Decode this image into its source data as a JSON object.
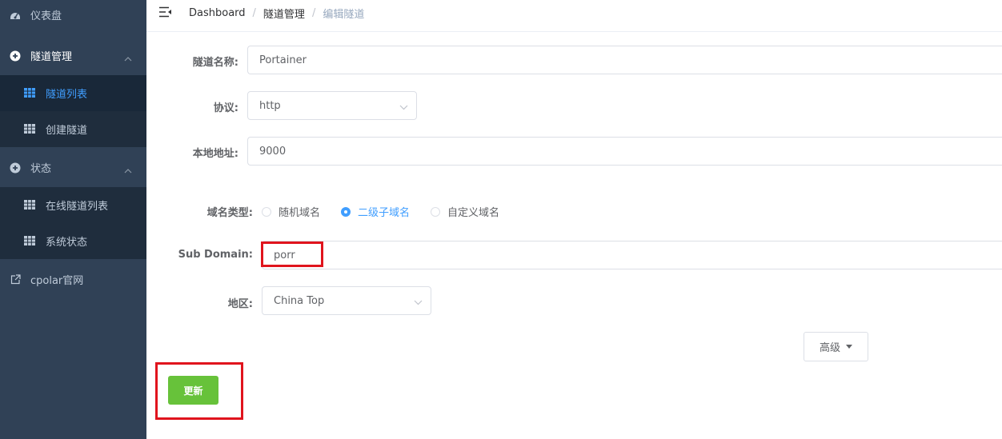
{
  "sidebar": {
    "items": [
      {
        "label": "仪表盘",
        "icon": "dashboard-icon"
      },
      {
        "label": "隧道管理",
        "icon": "plus-circle-icon",
        "expanded": true
      },
      {
        "label": "隧道列表",
        "icon": "grid-icon",
        "active": true
      },
      {
        "label": "创建隧道",
        "icon": "grid-icon"
      },
      {
        "label": "状态",
        "icon": "plus-circle-icon",
        "expanded": true
      },
      {
        "label": "在线隧道列表",
        "icon": "grid-icon"
      },
      {
        "label": "系统状态",
        "icon": "grid-icon"
      },
      {
        "label": "cpolar官网",
        "icon": "external-link-icon"
      }
    ]
  },
  "breadcrumb": [
    "Dashboard",
    "隧道管理",
    "编辑隧道"
  ],
  "breadcrumb_sep": "/",
  "form": {
    "tunnel_name": {
      "label": "隧道名称:",
      "value": "Portainer"
    },
    "protocol": {
      "label": "协议:",
      "value": "http"
    },
    "local_address": {
      "label": "本地地址:",
      "value": "9000"
    },
    "domain_type": {
      "label": "域名类型:",
      "options": [
        "随机域名",
        "二级子域名",
        "自定义域名"
      ],
      "selected": "二级子域名"
    },
    "sub_domain": {
      "label": "Sub Domain:",
      "value": "porr"
    },
    "region": {
      "label": "地区:",
      "value": "China Top"
    }
  },
  "buttons": {
    "advanced": "高级",
    "update": "更新"
  },
  "colors": {
    "sidebar_bg": "#304156",
    "submenu_bg": "#1f2d3d",
    "accent": "#409eff",
    "success": "#67c23a",
    "highlight": "#e0141d"
  }
}
